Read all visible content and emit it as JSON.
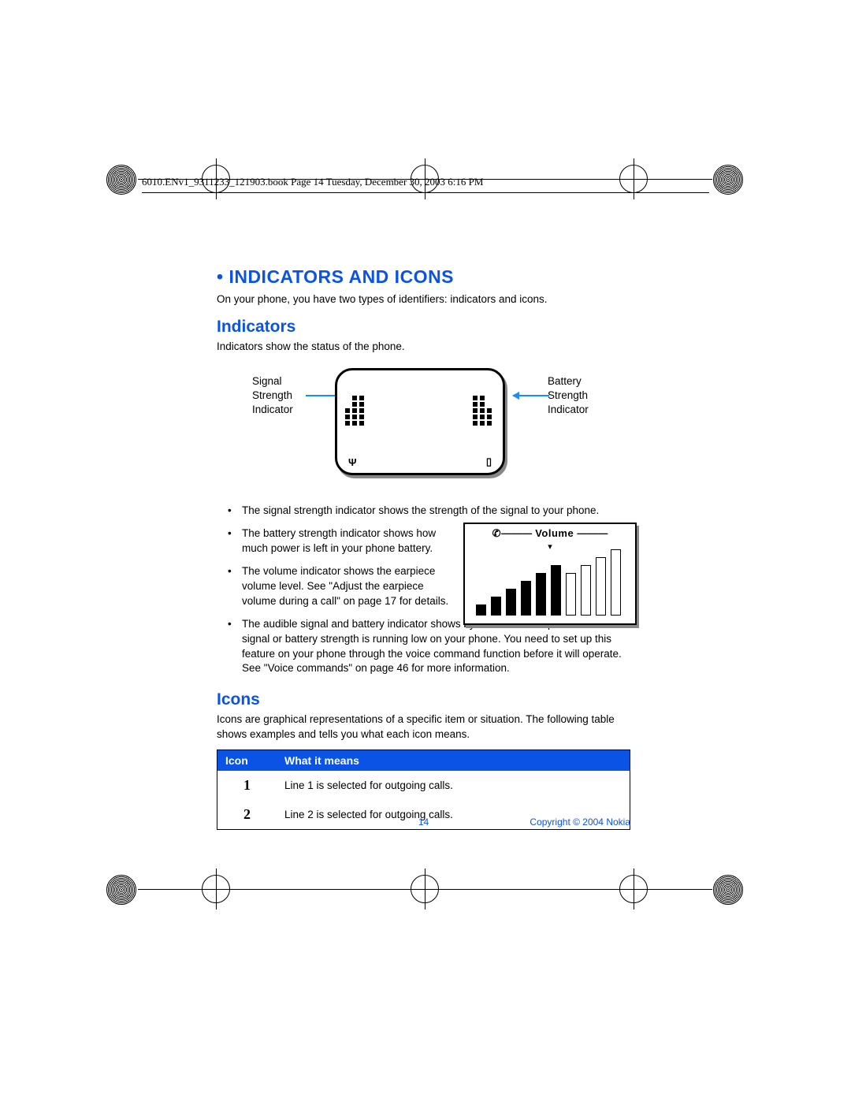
{
  "header": "6010.ENv1_9311233_121903.book  Page 14  Tuesday, December 30, 2003  6:16 PM",
  "main_heading": " • INDICATORS AND ICONS",
  "intro": "On your phone, you have two types of identifiers: indicators and icons.",
  "indicators": {
    "heading": "Indicators",
    "text": "Indicators show the status of the phone.",
    "label_left_1": "Signal",
    "label_left_2": "Strength",
    "label_left_3": "Indicator",
    "label_right_1": "Battery",
    "label_right_2": "Strength",
    "label_right_3": "Indicator",
    "bullets": {
      "b1": "The signal strength indicator shows the strength of the signal to your phone.",
      "b2": "The battery strength indicator shows how much power is left in your phone battery.",
      "b3": "The volume indicator shows the earpiece volume level. See \"Adjust the earpiece volume during a call\" on page 17 for details.",
      "b4": "The audible signal and battery indicator shows by a series of beeps that either the signal or battery strength is running low on your phone. You need to set up this feature on your phone through the voice command function before it will operate. See \"Voice commands\" on page 46 for more information."
    },
    "volume_label": "Volume"
  },
  "icons": {
    "heading": "Icons",
    "text": "Icons are graphical representations of a specific item or situation. The following table shows examples and tells you what each icon means.",
    "th_icon": "Icon",
    "th_meaning": "What it means",
    "rows": [
      {
        "icon": "1",
        "meaning": "Line 1 is selected for outgoing calls."
      },
      {
        "icon": "2",
        "meaning": "Line 2 is selected for outgoing calls."
      }
    ]
  },
  "footer": {
    "page": "14",
    "copyright": "Copyright © 2004 Nokia"
  }
}
